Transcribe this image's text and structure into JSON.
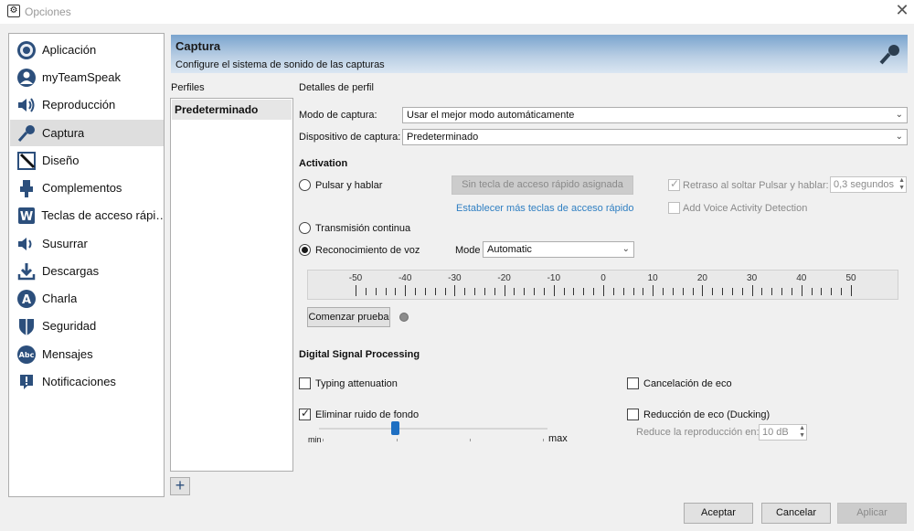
{
  "window": {
    "title": "Opciones",
    "close_glyph": "✕"
  },
  "sidebar": {
    "items": [
      {
        "label": "Aplicación",
        "icon": "application-icon"
      },
      {
        "label": "myTeamSpeak",
        "icon": "user-icon"
      },
      {
        "label": "Reproducción",
        "icon": "speaker-icon"
      },
      {
        "label": "Captura",
        "icon": "microphone-icon",
        "active": true
      },
      {
        "label": "Diseño",
        "icon": "design-icon"
      },
      {
        "label": "Complementos",
        "icon": "plugin-icon"
      },
      {
        "label": "Teclas de acceso rápi…",
        "icon": "hotkey-icon"
      },
      {
        "label": "Susurrar",
        "icon": "whisper-icon"
      },
      {
        "label": "Descargas",
        "icon": "download-icon"
      },
      {
        "label": "Charla",
        "icon": "chat-icon"
      },
      {
        "label": "Seguridad",
        "icon": "shield-icon"
      },
      {
        "label": "Mensajes",
        "icon": "messages-icon"
      },
      {
        "label": "Notificaciones",
        "icon": "notification-icon"
      }
    ]
  },
  "header": {
    "title": "Captura",
    "subtitle": "Configure el sistema de sonido de las capturas"
  },
  "profiles": {
    "label": "Perfiles",
    "items": [
      "Predeterminado"
    ],
    "add_glyph": "+"
  },
  "details": {
    "label": "Detalles de perfil",
    "capture_mode": {
      "label": "Modo de captura:",
      "value": "Usar el mejor modo automáticamente"
    },
    "capture_device": {
      "label": "Dispositivo de captura:",
      "value": "Predeterminado"
    }
  },
  "activation": {
    "title": "Activation",
    "ptt_label": "Pulsar y hablar",
    "hotkey_button": "Sin tecla de acceso rápido asignada",
    "more_hotkeys_link": "Establecer más teclas de acceso rápido",
    "release_delay_label": "Retraso al soltar Pulsar y hablar:",
    "release_delay_value": "0,3 segundos",
    "vad_label": "Add Voice Activity Detection",
    "continuous_label": "Transmisión continua",
    "voice_label": "Reconocimiento de voz",
    "selected": "voice",
    "mode_label": "Mode",
    "mode_value": "Automatic",
    "meter_ticks": [
      "-50",
      "-40",
      "-30",
      "-20",
      "-10",
      "0",
      "10",
      "20",
      "30",
      "40",
      "50"
    ],
    "test_button": "Comenzar prueba"
  },
  "dsp": {
    "title": "Digital Signal Processing",
    "typing_label": "Typing attenuation",
    "typing_checked": false,
    "noise_label": "Eliminar ruido de fondo",
    "noise_checked": true,
    "slider_min": "min",
    "slider_max": "max",
    "slider_level": 0.33,
    "echo_cancel_label": "Cancelación de eco",
    "echo_cancel_checked": false,
    "ducking_label": "Reducción de eco (Ducking)",
    "ducking_checked": false,
    "reduce_label": "Reduce la reproducción en:",
    "reduce_value": "10 dB"
  },
  "footer": {
    "ok": "Aceptar",
    "cancel": "Cancelar",
    "apply": "Aplicar"
  }
}
